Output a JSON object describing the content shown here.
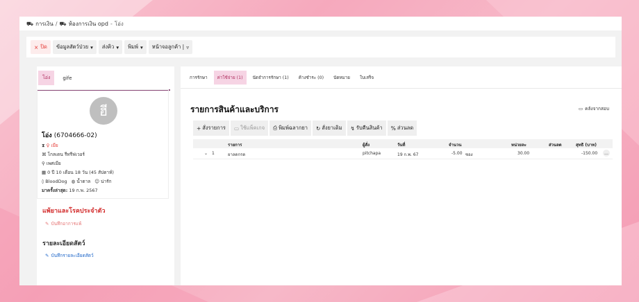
{
  "breadcrumb": {
    "item1": "การเงิน",
    "sep": "/",
    "item2": "ห้องการเงิน opd",
    "dash": "-",
    "current": "โอ่ง"
  },
  "toolbar": {
    "close_label": "ปิด",
    "pet_info_label": "ข้อมูลสัตว์ป่วย",
    "send_queue_label": "ส่งคิว",
    "print_label": "พิมพ์",
    "customer_screen_label": "หน้าจอลูกค้า |"
  },
  "left": {
    "tabs": [
      {
        "label": "โอ่ง",
        "active": true
      },
      {
        "label": "gife",
        "active": false
      }
    ],
    "avatar_letter": "ฮี",
    "pet_name": "โอ่ง",
    "pet_code": "(6704666-02)",
    "status": "เมีย",
    "breed": "โกลเดน รีทรีฟเวอร์",
    "gender": "เพศเมีย",
    "age": "0 ปี 10 เดือน 18 วัน (45 สัปดาห์)",
    "tags": [
      "BloodDog",
      "น้ำตาล",
      "น่ารัก"
    ],
    "last_visit_label": "มาครั้งล่าสุด:",
    "last_visit_date": "19 ก.พ. 2567",
    "allergy_title": "แพ้ยาและโรคประจำตัว",
    "allergy_link": "บันทึกอาการแพ้",
    "detail_title": "รายละเอียดสัตว์",
    "detail_link": "บันทึกรายละเอียดสัตว์"
  },
  "right": {
    "tabs": [
      {
        "label": "การรักษา",
        "active": false
      },
      {
        "label": "ค่าใช้จ่าย (1)",
        "active": true
      },
      {
        "label": "นัดจำการรักษา (1)",
        "active": false
      },
      {
        "label": "ค้างชำระ (0)",
        "active": false
      },
      {
        "label": "นัดหมาย",
        "active": false
      },
      {
        "label": "ใบเสร็จ",
        "active": false
      }
    ],
    "title": "รายการสินค้าและบริการ",
    "compare_label": "คลังจากสอบ",
    "actions": [
      {
        "icon": "+",
        "label": "สั่งรายการ",
        "disabled": false
      },
      {
        "icon": "▭",
        "label": "ใช้แพ็คเกจ",
        "disabled": true
      },
      {
        "icon": "⎙",
        "label": "พิมพ์ฉลากยา",
        "disabled": false
      },
      {
        "icon": "↻",
        "label": "สั่งยาเดิม",
        "disabled": false
      },
      {
        "icon": "↯",
        "label": "รับคืนสินค้า",
        "disabled": false
      },
      {
        "icon": "%",
        "label": "ส่วนลด",
        "disabled": false
      }
    ],
    "columns": [
      "รายการ",
      "ผู้สั่ง",
      "วันที่",
      "จำนวน",
      "หน่วยละ",
      "ส่วนลด",
      "สุทธิ (บาท)"
    ],
    "rows": [
      {
        "index": "1",
        "item": "ยาลดกรด",
        "by": "pitchapa",
        "date": "19 ก.พ. 67",
        "qty": "-5.00",
        "unit": "ซอง",
        "price": "30.00",
        "discount": "",
        "net": "-150.00"
      }
    ]
  }
}
